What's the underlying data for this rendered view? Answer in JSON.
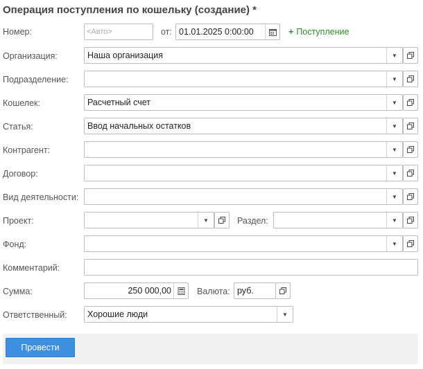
{
  "title": "Операция поступления по кошельку (создание) *",
  "number": {
    "label": "Номер:",
    "placeholder": "<Авто>"
  },
  "date": {
    "label": "от:",
    "value": "01.01.2025  0:00:00"
  },
  "receipt_link": {
    "label": "Поступление"
  },
  "organization": {
    "label": "Организация:",
    "value": "Наша организация"
  },
  "department": {
    "label": "Подразделение:",
    "value": ""
  },
  "wallet": {
    "label": "Кошелек:",
    "value": "Расчетный счет"
  },
  "article": {
    "label": "Статья:",
    "value": "Ввод начальных остатков"
  },
  "counterparty": {
    "label": "Контрагент:",
    "value": ""
  },
  "contract": {
    "label": "Договор:",
    "value": ""
  },
  "activity": {
    "label": "Вид деятельности:",
    "value": ""
  },
  "project": {
    "label": "Проект:",
    "value": ""
  },
  "section": {
    "label": "Раздел:",
    "value": ""
  },
  "fund": {
    "label": "Фонд:",
    "value": ""
  },
  "comment": {
    "label": "Комментарий:",
    "value": ""
  },
  "amount": {
    "label": "Сумма:",
    "value": "250 000,00"
  },
  "currency": {
    "label": "Валюта:",
    "value": "руб."
  },
  "responsible": {
    "label": "Ответственный:",
    "value": "Хорошие люди"
  },
  "footer": {
    "post_button": "Провести"
  },
  "colors": {
    "accent": "#3d8fe0",
    "link": "#2e8b2e",
    "border": "#bcbcbc"
  }
}
